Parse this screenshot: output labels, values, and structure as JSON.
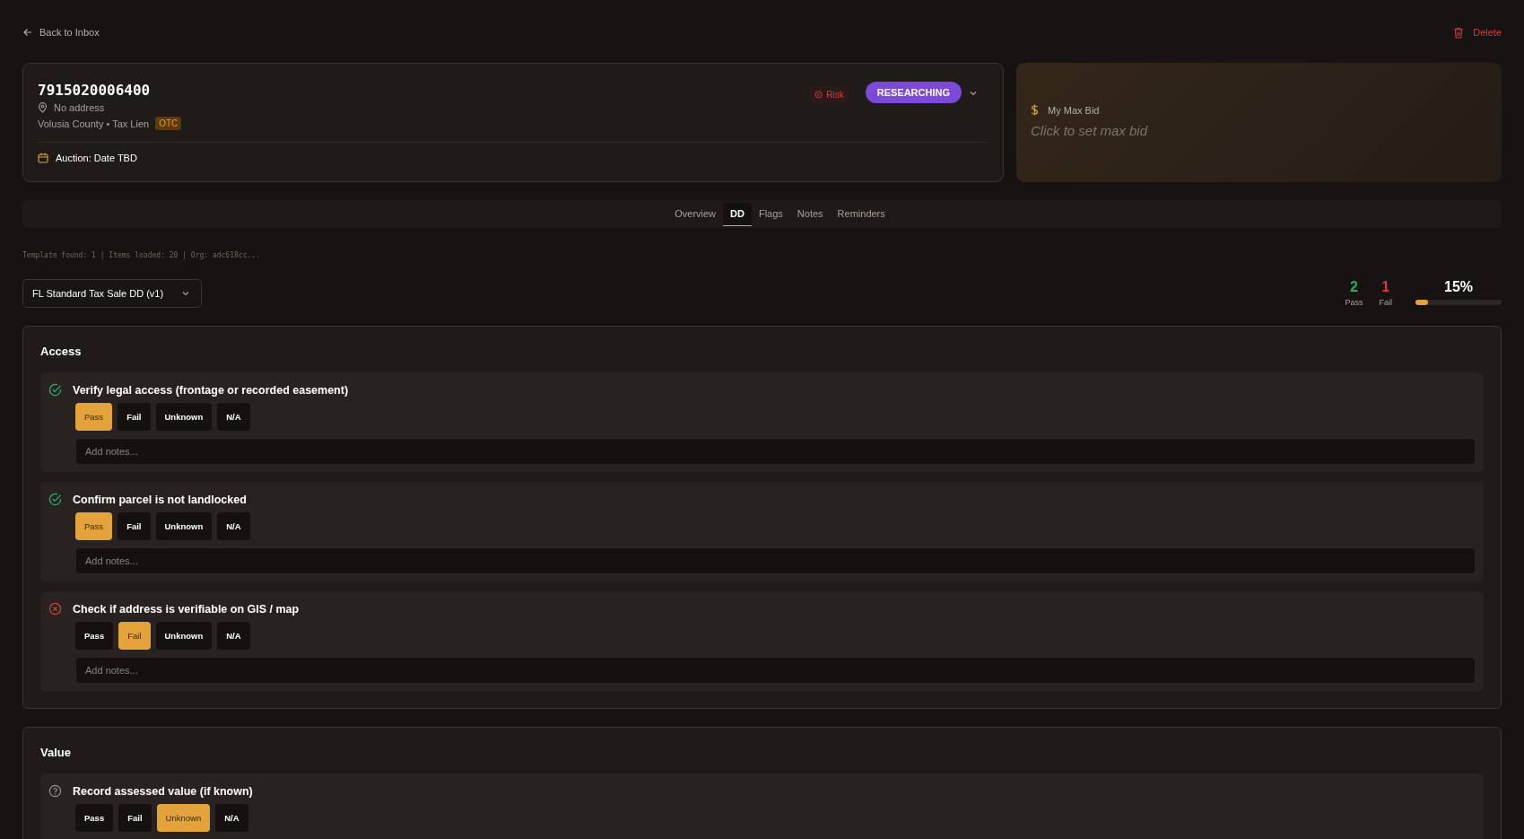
{
  "back_link": "Back to Inbox",
  "delete_button": "Delete",
  "property": {
    "id": "7915020006400",
    "address": "No address",
    "location": "Volusia County • Tax Lien",
    "tag": "OTC",
    "auction": "Auction: Date TBD",
    "risk": "Risk",
    "status": "RESEARCHING"
  },
  "max_bid": {
    "label": "My Max Bid",
    "placeholder": "Click to set max bid"
  },
  "tabs": [
    {
      "label": "Overview",
      "selected": false
    },
    {
      "label": "DD",
      "selected": true
    },
    {
      "label": "Flags",
      "selected": false
    },
    {
      "label": "Notes",
      "selected": false
    },
    {
      "label": "Reminders",
      "selected": false
    }
  ],
  "debug_line": "Template found: 1 | Items loaded: 20 | Org: adc618cc...",
  "template_select": {
    "value": "FL Standard Tax Sale DD (v1)"
  },
  "stats": {
    "pass_count": "2",
    "pass_label": "Pass",
    "fail_count": "1",
    "fail_label": "Fail",
    "percent": "15%",
    "level": 0.15
  },
  "sections": [
    {
      "title": "Access",
      "items": [
        {
          "label": "Verify legal access (frontage or recorded easement)",
          "kind": "pass",
          "options": [
            {
              "label": "Pass",
              "selected": true
            },
            {
              "label": "Fail",
              "selected": false
            },
            {
              "label": "Unknown",
              "selected": false
            },
            {
              "label": "N/A",
              "selected": false
            }
          ],
          "notes_placeholder": "Add notes..."
        },
        {
          "label": "Confirm parcel is not landlocked",
          "kind": "pass",
          "options": [
            {
              "label": "Pass",
              "selected": true
            },
            {
              "label": "Fail",
              "selected": false
            },
            {
              "label": "Unknown",
              "selected": false
            },
            {
              "label": "N/A",
              "selected": false
            }
          ],
          "notes_placeholder": "Add notes..."
        },
        {
          "label": "Check if address is verifiable on GIS / map",
          "kind": "fail",
          "options": [
            {
              "label": "Pass",
              "selected": false
            },
            {
              "label": "Fail",
              "selected": true
            },
            {
              "label": "Unknown",
              "selected": false
            },
            {
              "label": "N/A",
              "selected": false
            }
          ],
          "notes_placeholder": "Add notes..."
        }
      ]
    },
    {
      "title": "Value",
      "items": [
        {
          "label": "Record assessed value (if known)",
          "kind": "unknown",
          "options": [
            {
              "label": "Pass",
              "selected": false
            },
            {
              "label": "Fail",
              "selected": false
            },
            {
              "label": "Unknown",
              "selected": true
            },
            {
              "label": "N/A",
              "selected": false
            }
          ]
        }
      ]
    }
  ]
}
